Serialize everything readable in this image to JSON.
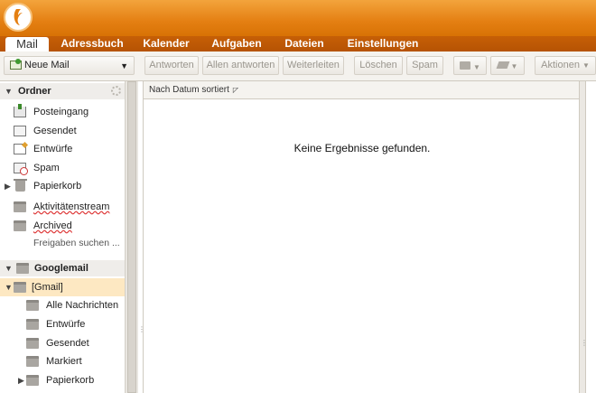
{
  "tabs": [
    "Mail",
    "Adressbuch",
    "Kalender",
    "Aufgaben",
    "Dateien",
    "Einstellungen"
  ],
  "toolbar": {
    "new_mail": "Neue Mail",
    "reply": "Antworten",
    "reply_all": "Allen antworten",
    "forward": "Weiterleiten",
    "delete": "Löschen",
    "spam": "Spam",
    "actions": "Aktionen"
  },
  "sidebar": {
    "section_title": "Ordner",
    "folders": [
      {
        "label": "Posteingang",
        "icon": "inbox-icon"
      },
      {
        "label": "Gesendet",
        "icon": "sent-icon"
      },
      {
        "label": "Entwürfe",
        "icon": "drafts-icon"
      },
      {
        "label": "Spam",
        "icon": "spam-icon"
      },
      {
        "label": "Papierkorb",
        "icon": "trash-icon"
      },
      {
        "label": "Aktivitätenstream",
        "icon": "folder-icon"
      },
      {
        "label": "Archived",
        "icon": "folder-icon"
      }
    ],
    "share_link": "Freigaben suchen ...",
    "account_title": "Googlemail",
    "account_folders": [
      {
        "label": "[Gmail]",
        "icon": "folder-icon"
      },
      {
        "label": "Alle Nachrichten",
        "icon": "folder-icon"
      },
      {
        "label": "Entwürfe",
        "icon": "folder-icon"
      },
      {
        "label": "Gesendet",
        "icon": "folder-icon"
      },
      {
        "label": "Markiert",
        "icon": "folder-icon"
      },
      {
        "label": "Papierkorb",
        "icon": "folder-icon"
      }
    ]
  },
  "list": {
    "sort_label": "Nach Datum sortiert",
    "empty_message": "Keine Ergebnisse gefunden."
  },
  "colors": {
    "brand_orange": "#e47f12",
    "tab_strip": "#b65304",
    "selected_folder": "#fde8c2"
  }
}
